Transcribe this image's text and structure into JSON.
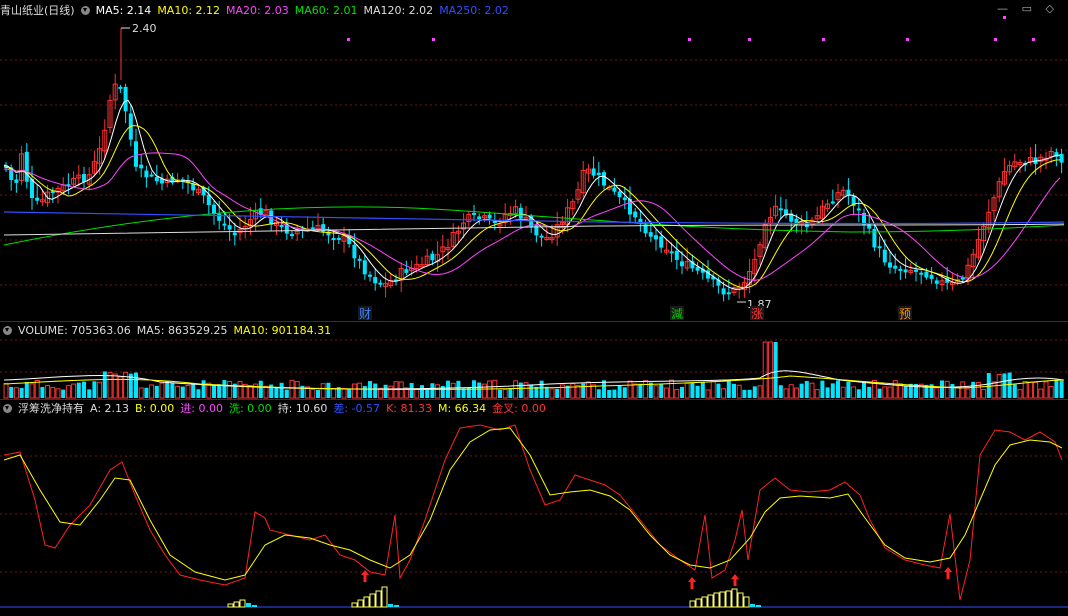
{
  "main_panel": {
    "stock_label": "青山纸业(日线)",
    "ma_labels": [
      {
        "text": "MA5: 2.14",
        "color": "#ffffff"
      },
      {
        "text": "MA10: 2.12",
        "color": "#ffff00"
      },
      {
        "text": "MA20: 2.03",
        "color": "#ff44ff"
      },
      {
        "text": "MA60: 2.01",
        "color": "#00e000"
      },
      {
        "text": "MA120: 2.02",
        "color": "#dddddd"
      },
      {
        "text": "MA250: 2.02",
        "color": "#3050ff"
      }
    ],
    "high_label": "2.40",
    "low_label": "1.87",
    "event_markers": [
      {
        "text": "财",
        "color": "#4080ff"
      },
      {
        "text": "減",
        "color": "#00cc00"
      },
      {
        "text": "涨",
        "color": "#ff3333"
      },
      {
        "text": "预",
        "color": "#ff8c00"
      }
    ]
  },
  "volume_panel": {
    "labels": [
      {
        "text": "VOLUME: 705363.06",
        "color": "#dddddd"
      },
      {
        "text": "MA5: 863529.25",
        "color": "#dddddd"
      },
      {
        "text": "MA10: 901184.31",
        "color": "#ffff00"
      }
    ]
  },
  "indicator_panel": {
    "labels": [
      {
        "text": "浮筹洗净持有",
        "color": "#dddddd"
      },
      {
        "text": "A: 2.13",
        "color": "#dddddd"
      },
      {
        "text": "B: 0.00",
        "color": "#ffff00"
      },
      {
        "text": "进: 0.00",
        "color": "#ff44ff"
      },
      {
        "text": "洗: 0.00",
        "color": "#00e000"
      },
      {
        "text": "持: 10.60",
        "color": "#dddddd"
      },
      {
        "text": "差: -0.57",
        "color": "#3050ff"
      },
      {
        "text": "K: 81.33",
        "color": "#ff3333"
      },
      {
        "text": "M: 66.34",
        "color": "#ffff00"
      },
      {
        "text": "金叉: 0.00",
        "color": "#ff3333"
      }
    ]
  },
  "colors": {
    "up": "#ff3232",
    "down": "#00e5ff",
    "grid": "#7a1414"
  }
}
